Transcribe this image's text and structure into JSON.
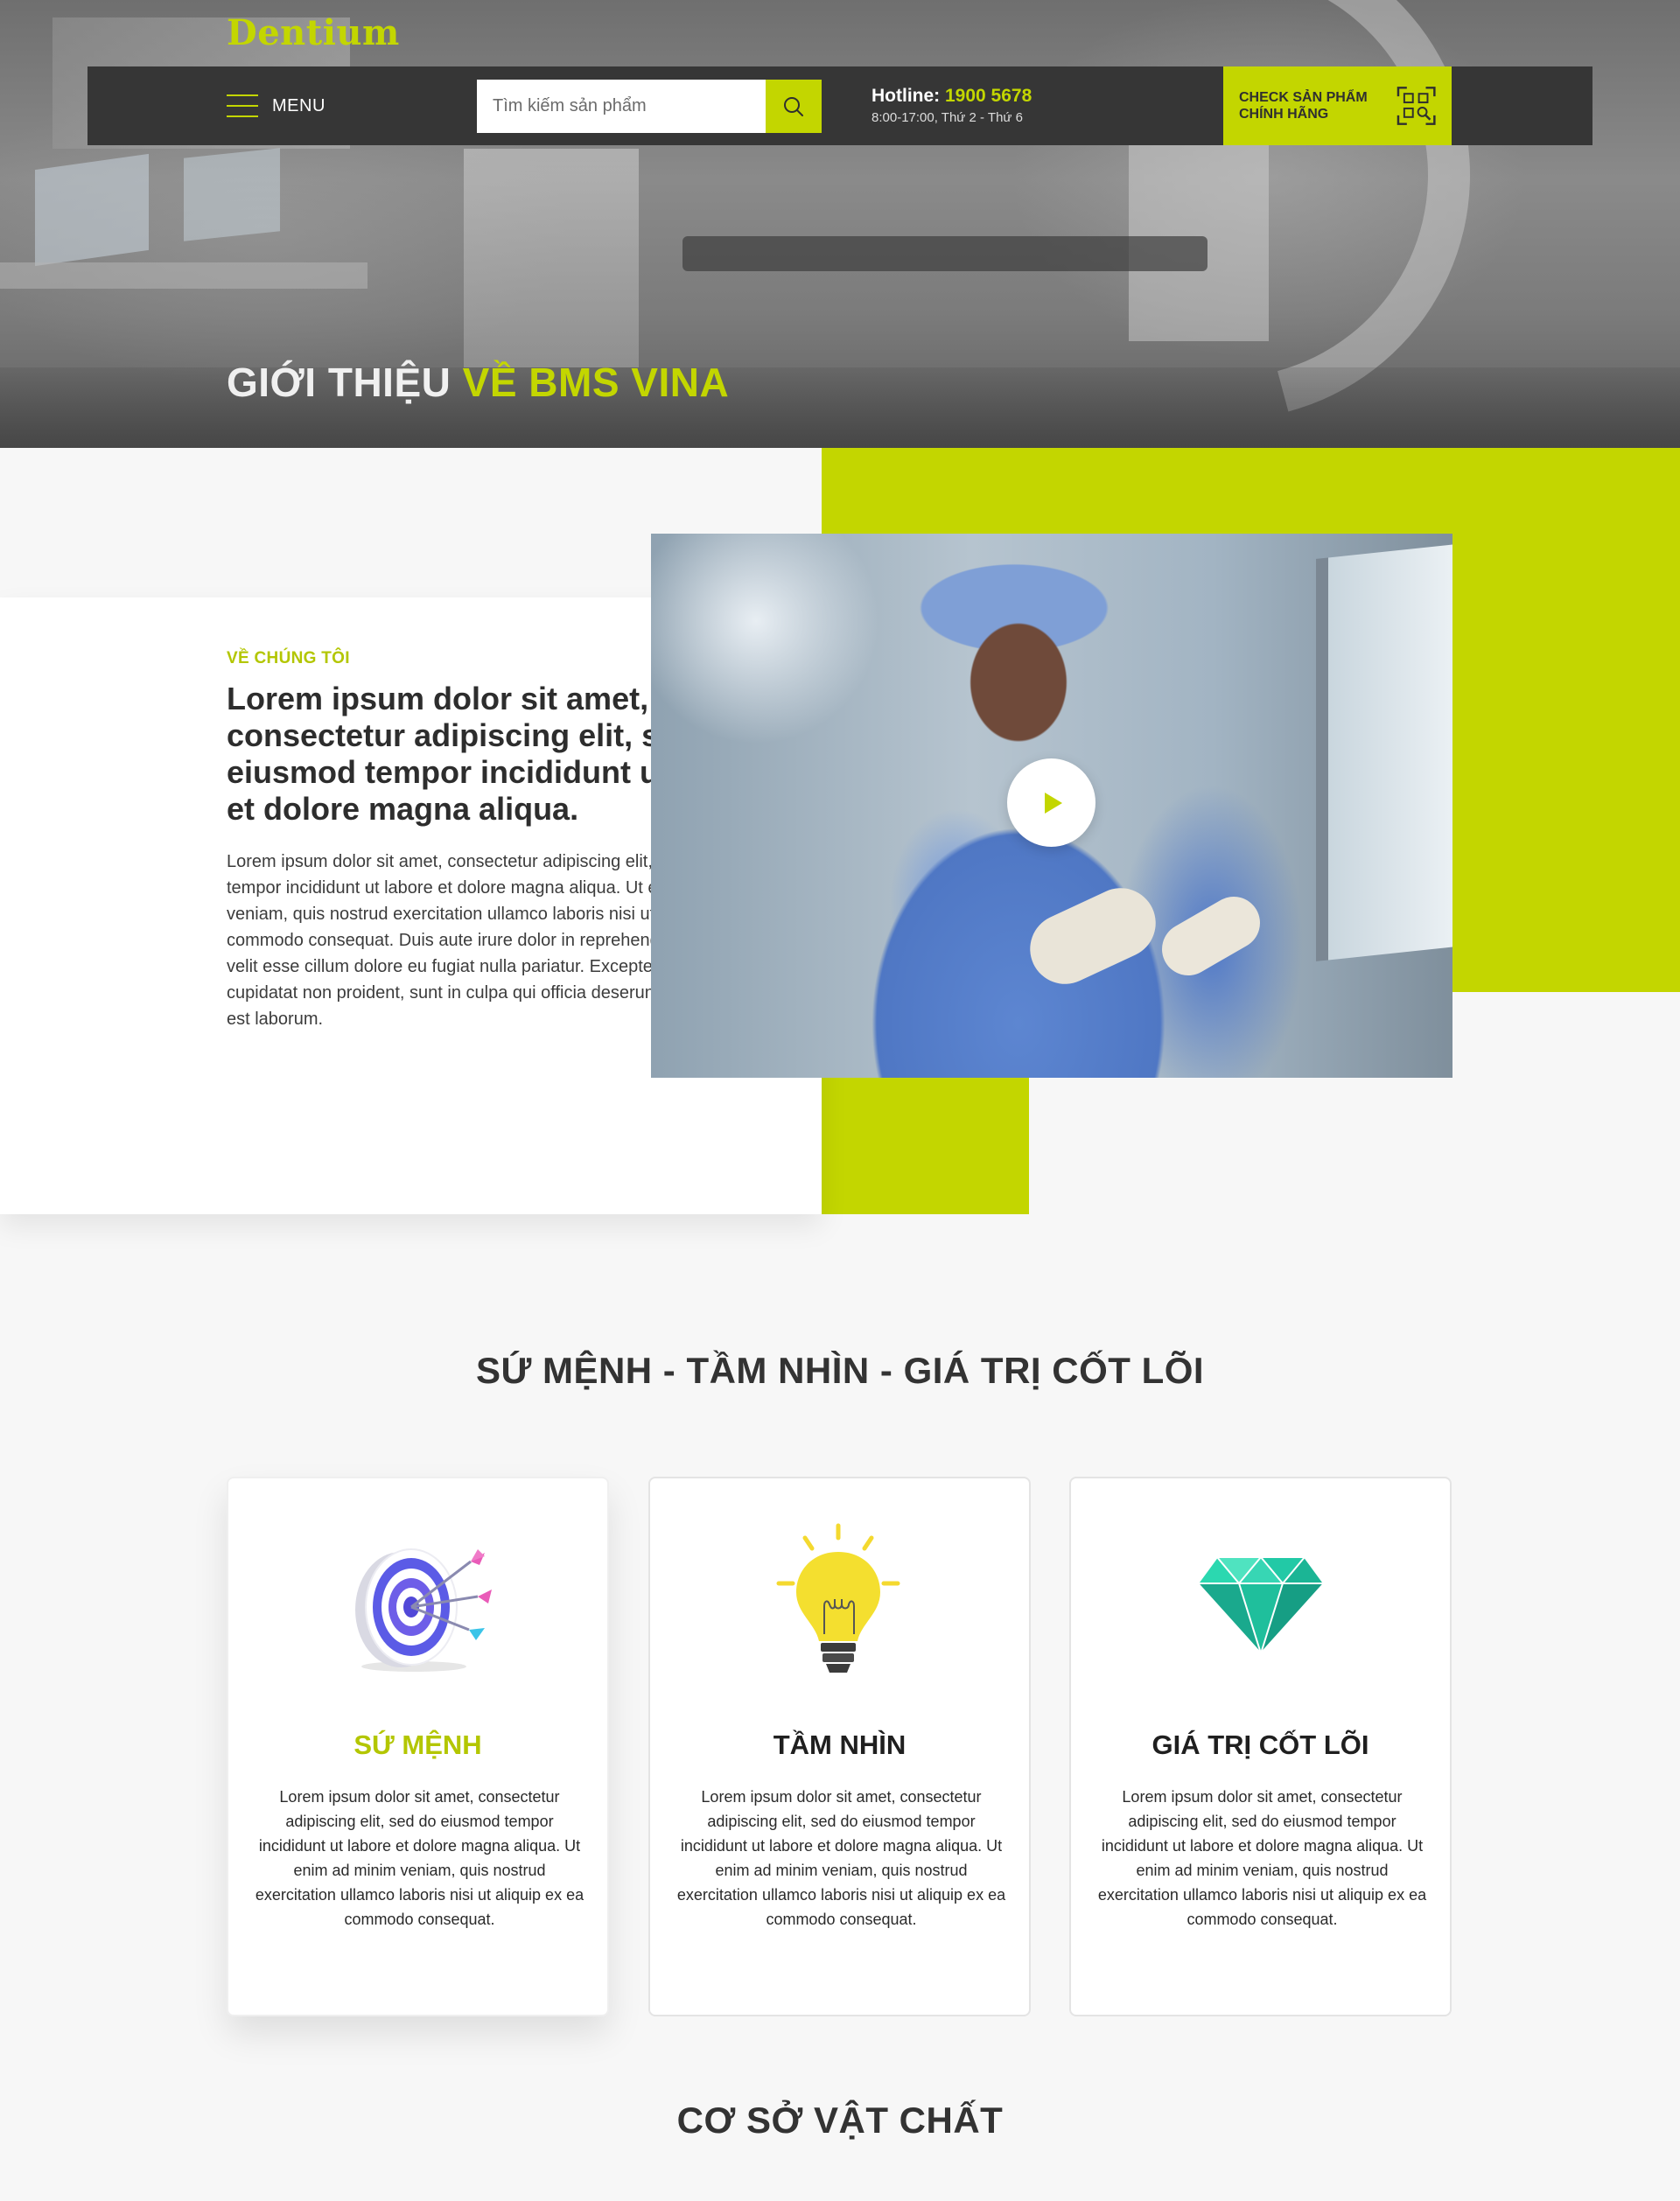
{
  "header": {
    "logo": "Dentium",
    "menu_label": "MENU",
    "search": {
      "placeholder": "Tìm kiếm sản phẩm"
    },
    "hotline": {
      "label": "Hotline:",
      "number": "1900 5678",
      "hours": "8:00-17:00, Thứ 2 - Thứ 6"
    },
    "check_button": {
      "line1": "CHECK SẢN PHẨM",
      "line2": "CHÍNH HÃNG"
    }
  },
  "hero": {
    "title_part1": "GIỚI THIỆU",
    "title_part2": "VỀ BMS VINA"
  },
  "about": {
    "eyebrow": "VỀ CHÚNG TÔI",
    "heading": "Lorem ipsum dolor sit amet, consectetur adipiscing elit, sed do eiusmod tempor incididunt ut labore et dolore magna aliqua.",
    "body": "Lorem ipsum dolor sit amet, consectetur adipiscing elit, sed do eiusmod tempor incididunt ut labore et dolore magna aliqua. Ut enim ad minim veniam, quis nostrud exercitation ullamco laboris nisi ut aliquip ex ea commodo consequat. Duis aute irure dolor in reprehenderit in voluptate velit esse cillum dolore eu fugiat nulla pariatur. Excepteur sint occaecat cupidatat non proident, sunt in culpa qui officia deserunt mollit anim id est laborum."
  },
  "mission": {
    "title": "SỨ MỆNH - TẦM NHÌN - GIÁ TRỊ CỐT LÕI",
    "cards": [
      {
        "icon": "target-icon",
        "title": "SỨ MỆNH",
        "text": "Lorem ipsum dolor sit amet, consectetur adipiscing elit, sed do eiusmod tempor incididunt ut labore et dolore magna aliqua. Ut enim ad minim veniam, quis nostrud exercitation ullamco laboris nisi ut aliquip ex ea commodo consequat."
      },
      {
        "icon": "lightbulb-icon",
        "title": "TẦM NHÌN",
        "text": "Lorem ipsum dolor sit amet, consectetur adipiscing elit, sed do eiusmod tempor incididunt ut labore et dolore magna aliqua. Ut enim ad minim veniam, quis nostrud exercitation ullamco laboris nisi ut aliquip ex ea commodo consequat."
      },
      {
        "icon": "diamond-icon",
        "title": "GIÁ TRỊ CỐT LÕI",
        "text": "Lorem ipsum dolor sit amet, consectetur adipiscing elit, sed do eiusmod tempor incididunt ut labore et dolore magna aliqua. Ut enim ad minim veniam, quis nostrud exercitation ullamco laboris nisi ut aliquip ex ea commodo consequat."
      }
    ]
  },
  "facility": {
    "title": "CƠ SỞ VẬT CHẤT"
  },
  "colors": {
    "accent": "#c3d600",
    "dark_bar": "#363636",
    "background": "#f7f7f7"
  }
}
